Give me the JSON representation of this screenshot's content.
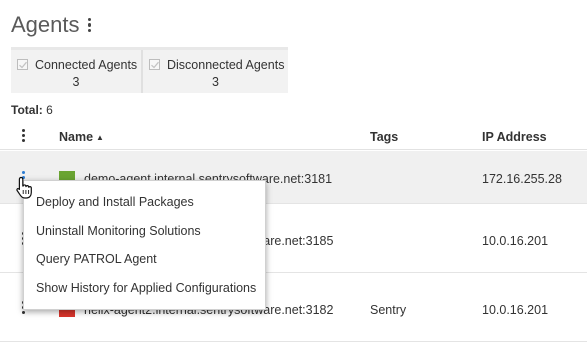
{
  "page": {
    "title": "Agents"
  },
  "filters": [
    {
      "label": "Connected Agents",
      "count": "3",
      "checked": true
    },
    {
      "label": "Disconnected Agents",
      "count": "3",
      "checked": true
    }
  ],
  "total": {
    "label": "Total:",
    "value": "6"
  },
  "table": {
    "columns": {
      "name": "Name",
      "tags": "Tags",
      "ip": "IP Address"
    },
    "sort_indicator": "▲",
    "rows": [
      {
        "name": "demo-agent.internal.sentrysoftware.net:3181",
        "tags": "",
        "ip": "172.16.255.28",
        "status": "connected",
        "status_color": "#6aa432"
      },
      {
        "name": "helix-agent1.internal.sentrysoftware.net:3185",
        "tags": "",
        "ip": "10.0.16.201",
        "status": "connected",
        "status_color": "#6aa432"
      },
      {
        "name": "helix-agent2.internal.sentrysoftware.net:3182",
        "tags": "Sentry",
        "ip": "10.0.16.201",
        "status": "disconnected",
        "status_color": "#d9342b"
      }
    ]
  },
  "context_menu": {
    "items": [
      "Deploy and Install Packages",
      "Uninstall Monitoring Solutions",
      "Query PATROL Agent",
      "Show History for Applied Configurations"
    ]
  },
  "icons": {
    "title_menu": "vertical-ellipsis-icon",
    "header_menu": "vertical-ellipsis-icon",
    "row_menu": "vertical-ellipsis-icon",
    "checkbox": "checkmark-icon",
    "status": "agent-status-icon",
    "cursor": "hand-pointer-icon"
  },
  "colors": {
    "accent": "#2b7cd3",
    "connected": "#6aa432",
    "disconnected": "#d9342b"
  }
}
